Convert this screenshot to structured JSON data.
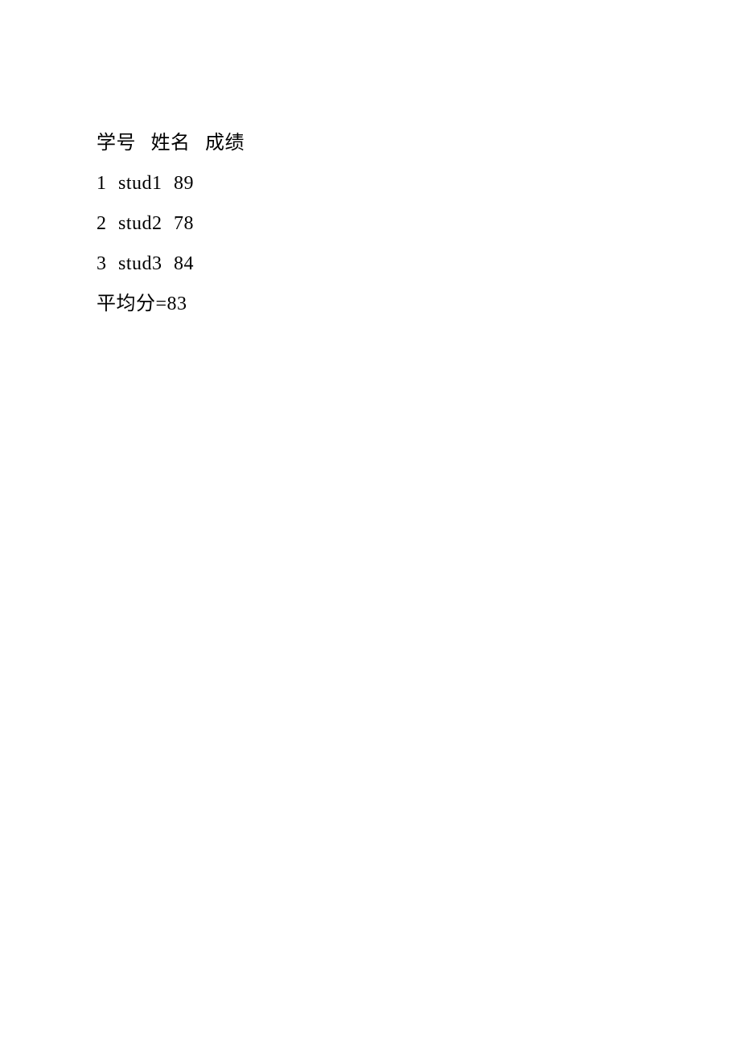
{
  "header": {
    "col1": "学号",
    "col2": "姓名",
    "col3": "成绩"
  },
  "rows": [
    {
      "id": "1",
      "name": "stud1",
      "score": "89"
    },
    {
      "id": "2",
      "name": "stud2",
      "score": "78"
    },
    {
      "id": "3",
      "name": "stud3",
      "score": "84"
    }
  ],
  "average": {
    "label": "平均分=",
    "value": "83"
  }
}
